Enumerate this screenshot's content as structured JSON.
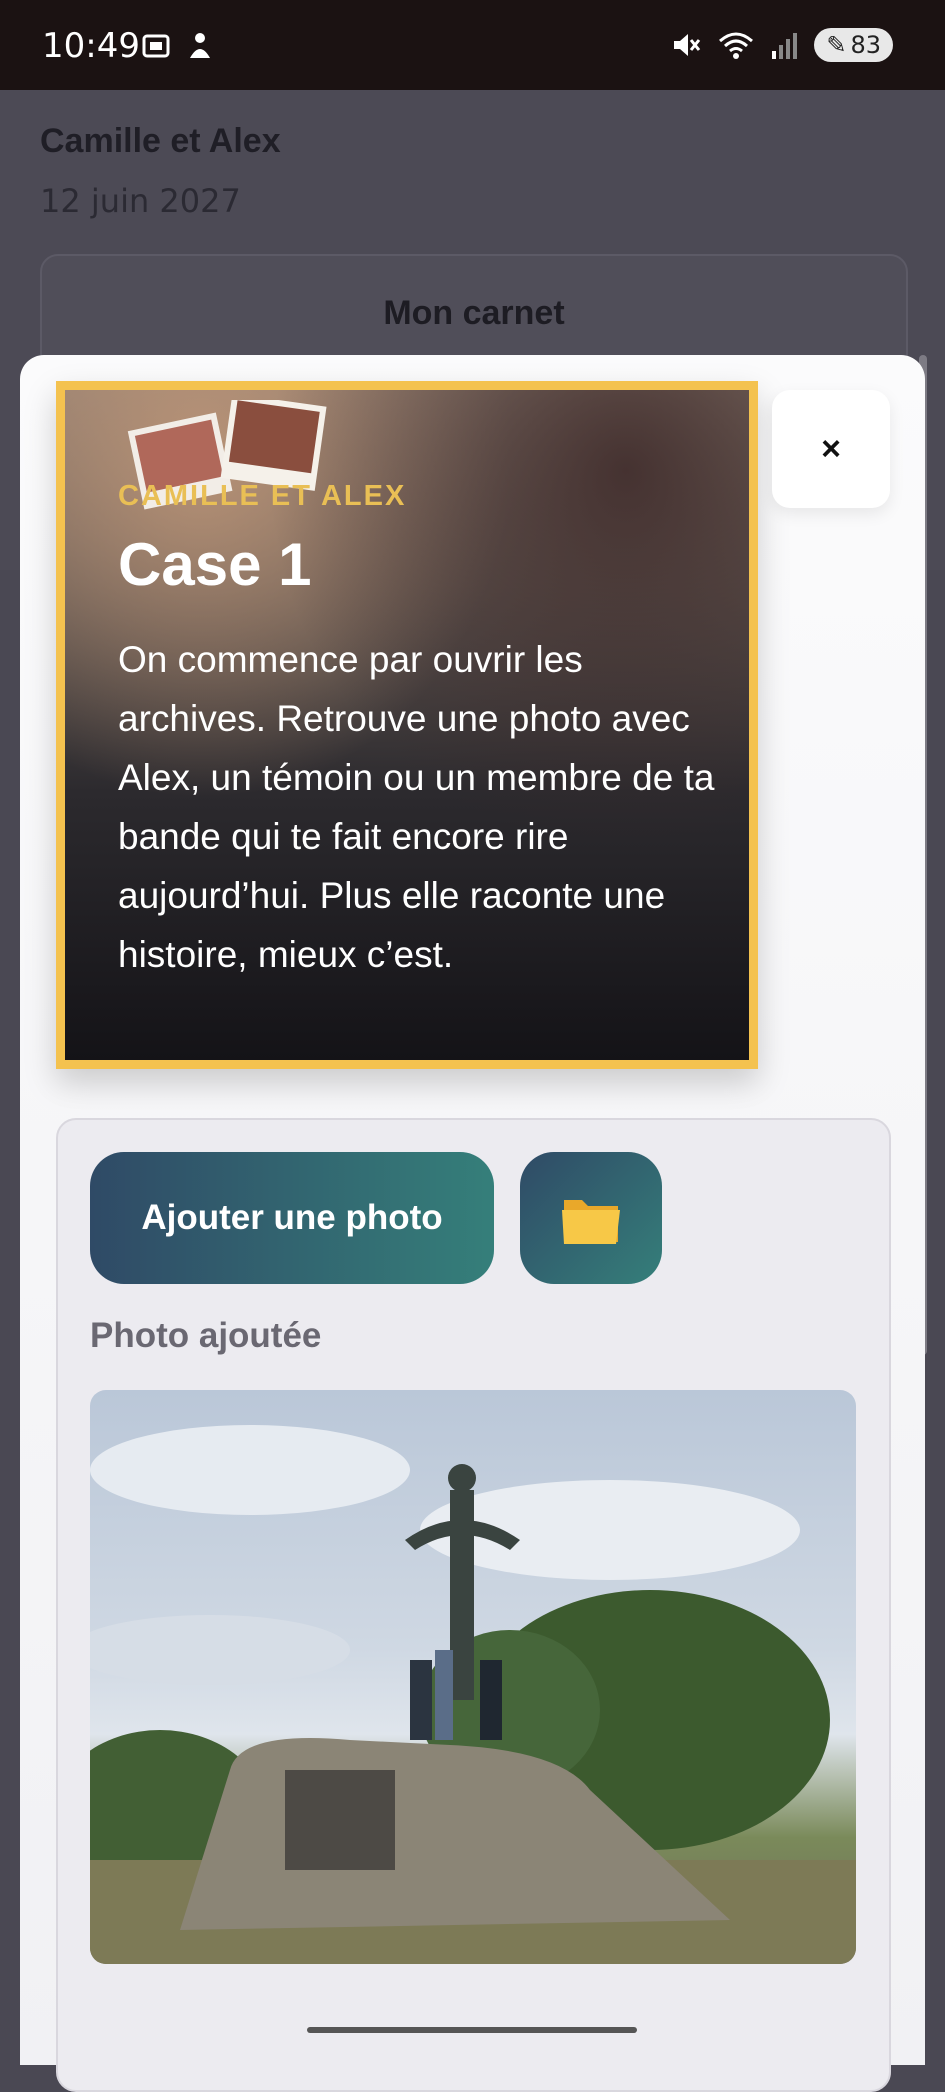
{
  "status_bar": {
    "time": "10:49",
    "battery": "83",
    "wifi_label": "6"
  },
  "background_page": {
    "title": "Camille et Alex",
    "date": "12 juin 2027",
    "card_title": "Mon carnet"
  },
  "modal": {
    "eyebrow": "CAMILLE ET ALEX",
    "title": "Case 1",
    "description": "On commence par ouvrir les archives. Retrouve une photo avec Alex, un témoin ou un membre de ta bande qui te fait encore rire aujourd’hui. Plus elle raconte une histoire, mieux c’est.",
    "close_label": "×",
    "accent_color": "#f4c24f"
  },
  "upload": {
    "add_photo_label": "Ajouter une photo",
    "folder_icon": "folder-icon",
    "photo_added_label": "Photo ajoutée",
    "photo_icon": "uploaded-photo"
  }
}
